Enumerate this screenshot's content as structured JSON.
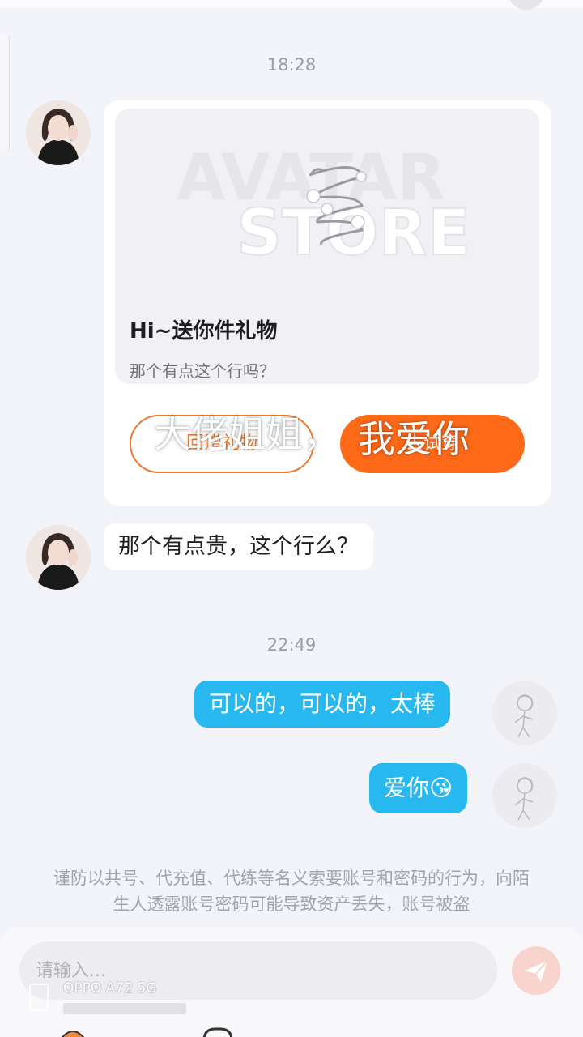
{
  "messages": {
    "time1": "18:28",
    "time2": "22:49",
    "gift_card": {
      "image_text_line1": "AVATAR",
      "image_text_line2": "STORE",
      "title": "Hi~送你件礼物",
      "subtitle": "那个有点这个行吗？",
      "decline_button": "回赠礼物",
      "accept_button": "去试穿"
    },
    "incoming_text": "那个有点贵，这个行么？",
    "outgoing1": "可以的，可以的，太棒",
    "outgoing2_text": "爱你",
    "outgoing2_emoji": "😘"
  },
  "overlay": {
    "caption_left": "大佬姐姐，",
    "caption_right": "我爱你"
  },
  "notice": {
    "text": "谨防以共号、代充值、代练等名义索要账号和密码的行为，向陌生人透露账号密码可能导致资产丢失，账号被盗"
  },
  "input": {
    "placeholder": "请输入..."
  },
  "watermark": {
    "device": "OPPO A72 5G"
  },
  "colors": {
    "accent_orange": "#ff6a18",
    "bubble_blue": "#27b8ef",
    "send_button": "#f9d4cf"
  },
  "icons": {
    "send": "paper-plane-icon",
    "gift_image": "spiral-bracelet-icon"
  }
}
